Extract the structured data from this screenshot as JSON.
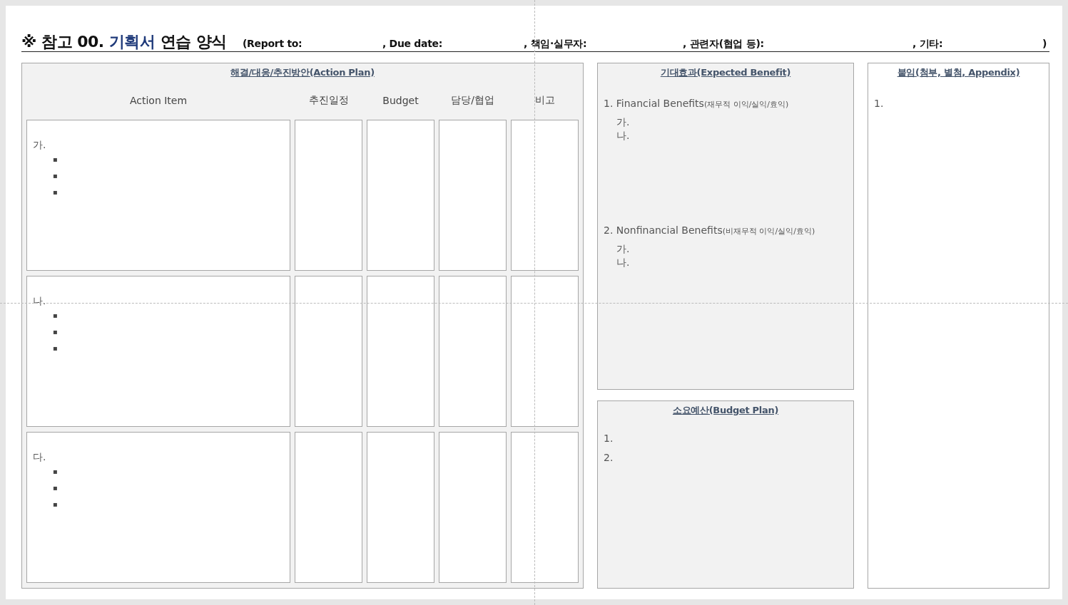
{
  "title": {
    "prefix": "※ 참고 00. ",
    "highlight": "기획서",
    "suffix": " 연습 양식"
  },
  "header_fields": [
    "(Report to:",
    ", Due date:",
    ", 책임·실무자:",
    ", 관련자(협업 등):",
    ", 기타:",
    ")"
  ],
  "action_plan": {
    "heading": "해결/대응/추진방안(Action Plan)",
    "columns": [
      "Action Item",
      "추진일정",
      "Budget",
      "담당/협업",
      "비고"
    ],
    "rows": [
      {
        "label": "가.",
        "bullets": [
          "▪",
          "▪",
          "▪"
        ]
      },
      {
        "label": "나.",
        "bullets": [
          "▪",
          "▪",
          "▪"
        ]
      },
      {
        "label": "다.",
        "bullets": [
          "▪",
          "▪",
          "▪"
        ]
      }
    ]
  },
  "expected_benefit": {
    "heading": "기대효과(Expected Benefit)",
    "sections": [
      {
        "title": "1. Financial Benefits",
        "note": "(재무적 이익/실익/효익)",
        "items": [
          "가.",
          "나."
        ]
      },
      {
        "title": "2. Nonfinancial Benefits",
        "note": "(비재무적 이익/실익/효익)",
        "items": [
          "가.",
          "나."
        ]
      }
    ]
  },
  "budget_plan": {
    "heading": "소요예산(Budget Plan)",
    "items": [
      "1.",
      "2."
    ]
  },
  "appendix": {
    "heading": "붙임(첨부, 별첨, Appendix)",
    "items": [
      "1."
    ]
  }
}
